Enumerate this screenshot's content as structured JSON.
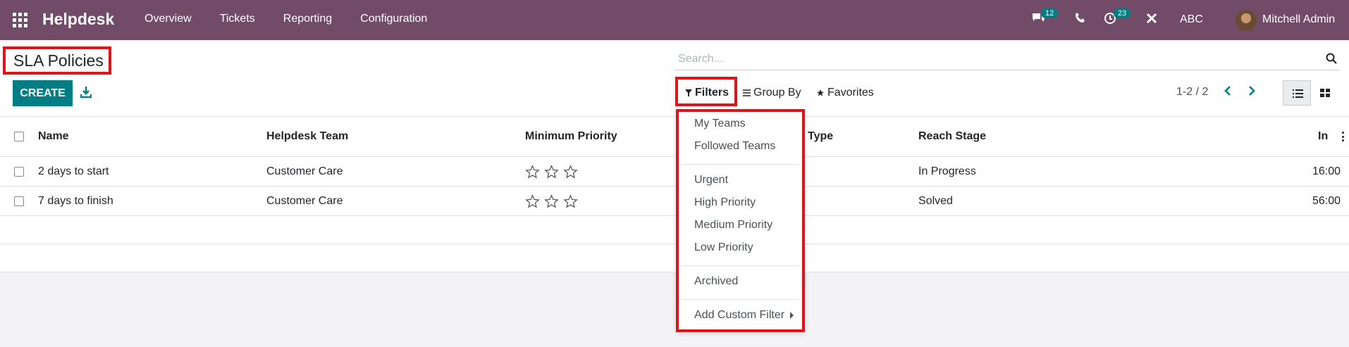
{
  "navbar": {
    "brand": "Helpdesk",
    "menu": [
      "Overview",
      "Tickets",
      "Reporting",
      "Configuration"
    ],
    "messages_badge": "12",
    "activities_badge": "23",
    "company": "ABC",
    "user": "Mitchell Admin",
    "bg_color": "#714b67"
  },
  "control_panel": {
    "title": "SLA Policies",
    "create_label": "CREATE",
    "search_placeholder": "Search...",
    "filters_label": "Filters",
    "groupby_label": "Group By",
    "favorites_label": "Favorites",
    "pager": "1-2 / 2",
    "accent_color": "#017e84",
    "highlight_color": "#e0131b"
  },
  "table": {
    "columns": [
      "Name",
      "Helpdesk Team",
      "Minimum Priority",
      "Type",
      "Reach Stage",
      "In"
    ],
    "rows": [
      {
        "name": "2 days to start",
        "team": "Customer Care",
        "priority_stars": 0,
        "reach_stage": "In Progress",
        "in": "16:00"
      },
      {
        "name": "7 days to finish",
        "team": "Customer Care",
        "priority_stars": 0,
        "reach_stage": "Solved",
        "in": "56:00"
      }
    ]
  },
  "filters_dropdown": {
    "items": [
      "My Teams",
      "Followed Teams",
      "Urgent",
      "High Priority",
      "Medium Priority",
      "Low Priority",
      "Archived",
      "Add Custom Filter"
    ]
  }
}
